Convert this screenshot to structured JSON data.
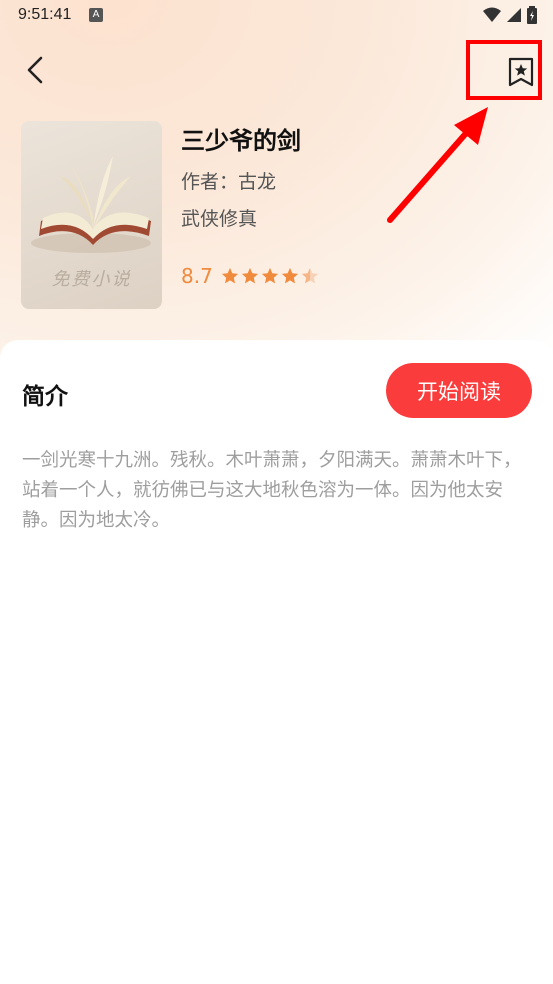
{
  "status_bar": {
    "time": "9:51:41",
    "notification_icon_label": "A"
  },
  "nav": {
    "back_icon": "chevron-left-icon",
    "bookmark_icon": "bookmark-star-icon"
  },
  "book": {
    "title": "三少爷的剑",
    "author": "作者：古龙",
    "genre": "武侠修真",
    "rating": "8.7",
    "stars_filled": 4.5,
    "stars_total": 5,
    "cover_watermark": "免费小说"
  },
  "intro": {
    "heading": "简介",
    "read_button": "开始阅读",
    "text": "一剑光寒十九洲。残秋。木叶萧萧，夕阳满天。萧萧木叶下，站着一个人，就彷佛已与这大地秋色溶为一体。因为他太安静。因为地太冷。"
  },
  "colors": {
    "accent_red": "#fa3c3c",
    "rating_orange": "#f08a3c",
    "annotation_red": "#ff0000"
  }
}
